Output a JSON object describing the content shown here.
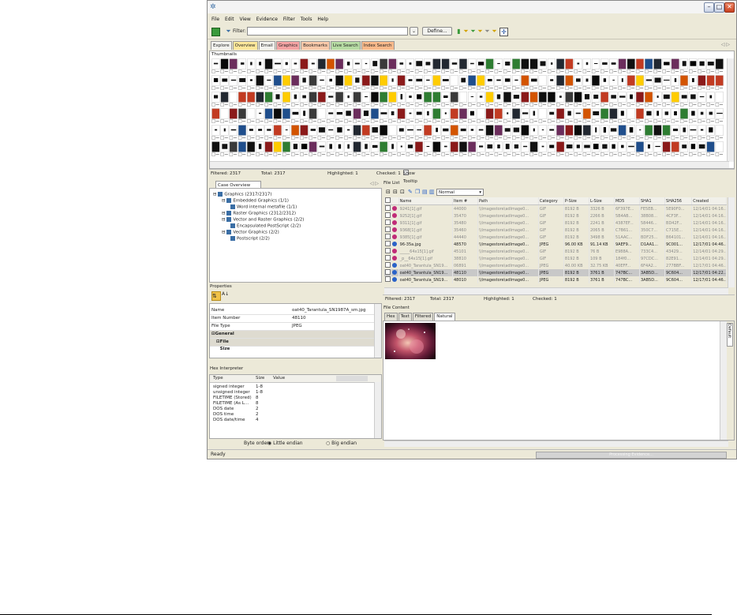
{
  "menu": [
    "File",
    "Edit",
    "View",
    "Evidence",
    "Filter",
    "Tools",
    "Help"
  ],
  "toolbar": {
    "filter_label": "Filter:",
    "define_label": "Define..."
  },
  "view_tabs": [
    {
      "label": "Explore",
      "color": "#f2f2ee"
    },
    {
      "label": "Overview",
      "color": "#fde79a"
    },
    {
      "label": "Email",
      "color": "#f2f2ee"
    },
    {
      "label": "Graphics",
      "color": "#f5a3a3"
    },
    {
      "label": "Bookmarks",
      "color": "#f9c9a9"
    },
    {
      "label": "Live Search",
      "color": "#b6dba3"
    },
    {
      "label": "Index Search",
      "color": "#f9b98a"
    }
  ],
  "thumbnails": {
    "title": "Thumbnails",
    "status": {
      "filtered": "Filtered: 2317",
      "total": "Total: 2317",
      "highlighted": "Highlighted: 1",
      "checked": "Checked: 1",
      "tooltip": "Show Tooltip"
    }
  },
  "case_overview": {
    "tab": "Case Overview",
    "tree": [
      {
        "label": "Graphics (2317/2317)",
        "level": 0
      },
      {
        "label": "Embedded Graphics (1/1)",
        "level": 1
      },
      {
        "label": "Word internal metafile (1/1)",
        "level": 2
      },
      {
        "label": "Raster Graphics (2312/2312)",
        "level": 1
      },
      {
        "label": "Vector and Raster Graphics (2/2)",
        "level": 1
      },
      {
        "label": "Encapsulated PostScript (2/2)",
        "level": 2
      },
      {
        "label": "Vector Graphics (2/2)",
        "level": 1
      },
      {
        "label": "Postscript (2/2)",
        "level": 2
      }
    ]
  },
  "properties": {
    "title": "Properties",
    "rows": [
      {
        "k": "Name",
        "v": "oat40_Tarantula_SN1987A_sm.jpg"
      },
      {
        "k": "Item Number",
        "v": "48110"
      },
      {
        "k": "File Type",
        "v": "JPEG"
      }
    ],
    "section": "General Info",
    "subsection": "File Size"
  },
  "hex_interpreter": {
    "title": "Hex Interpreter",
    "headers": [
      "Type",
      "Size",
      "Value"
    ],
    "rows": [
      {
        "t": "signed integer",
        "s": "1-8"
      },
      {
        "t": "unsigned integer",
        "s": "1-8"
      },
      {
        "t": "FILETIME (Stored)",
        "s": "8"
      },
      {
        "t": "FILETIME (As L...",
        "s": "8"
      },
      {
        "t": "DOS date",
        "s": "2"
      },
      {
        "t": "DOS time",
        "s": "2"
      },
      {
        "t": "DOS date/time",
        "s": "4"
      }
    ],
    "byte_order_label": "Byte order:",
    "little": "Little endian",
    "big": "Big endian"
  },
  "file_list": {
    "title": "File List",
    "view_mode": "Normal",
    "headers": [
      "Name",
      "Item #",
      "Path",
      "Category",
      "P-Size",
      "L-Size",
      "MD5",
      "SHA1",
      "SHA256",
      "Created"
    ],
    "rows": [
      {
        "name": "9241[1].gif",
        "item": "44000",
        "path": "\\\\Imagestore\\adlmage0...",
        "cat": "GIF",
        "psize": "8192 B",
        "lsize": "3326 B",
        "md5": "6F397E...",
        "sha1": "FE5EB...",
        "sha256": "5E90F0...",
        "created": "12/14/01 04:16...",
        "dim": true
      },
      {
        "name": "9252[1].gif",
        "item": "35470",
        "path": "\\\\Imagestore\\adlmage0...",
        "cat": "GIF",
        "psize": "8192 B",
        "lsize": "2266 B",
        "md5": "5B4AB...",
        "sha1": "38B08...",
        "sha256": "4CF3F...",
        "created": "12/14/01 04:16...",
        "dim": true
      },
      {
        "name": "9311[1].gif",
        "item": "35480",
        "path": "\\\\Imagestore\\adlmage0...",
        "cat": "GIF",
        "psize": "8192 B",
        "lsize": "2241 B",
        "md5": "4387EF...",
        "sha1": "58446...",
        "sha256": "BD42F...",
        "created": "12/14/01 04:16...",
        "dim": true
      },
      {
        "name": "9368[1].gif",
        "item": "35460",
        "path": "\\\\Imagestore\\adlmage0...",
        "cat": "GIF",
        "psize": "8192 B",
        "lsize": "2065 B",
        "md5": "C7B61...",
        "sha1": "350C7...",
        "sha256": "C715E...",
        "created": "12/14/01 04:16...",
        "dim": true
      },
      {
        "name": "9385[1].gif",
        "item": "44440",
        "path": "\\\\Imagestore\\adlmage0...",
        "cat": "GIF",
        "psize": "8192 B",
        "lsize": "3498 B",
        "md5": "51AAC...",
        "sha1": "BDF25...",
        "sha256": "B64101...",
        "created": "12/14/01 04:16...",
        "dim": true
      },
      {
        "name": "96-35a.jpg",
        "item": "48570",
        "path": "\\\\Imagestore\\adlmage0...",
        "cat": "JPEG",
        "psize": "96.00 KB",
        "lsize": "91.14 KB",
        "md5": "9AEF9...",
        "sha1": "D1AA1...",
        "sha256": "9C001...",
        "created": "12/17/01 04:46...",
        "dim": false
      },
      {
        "name": "_____64x15[1].gif",
        "item": "45101",
        "path": "\\\\Imagestore\\adlmage0...",
        "cat": "GIF",
        "psize": "8192 B",
        "lsize": "76 B",
        "md5": "E988A...",
        "sha1": "733C4...",
        "sha256": "43429...",
        "created": "12/14/01 04:29...",
        "dim": true
      },
      {
        "name": "_p__64x15[1].gif",
        "item": "38810",
        "path": "\\\\Imagestore\\adlmage0...",
        "cat": "GIF",
        "psize": "8192 B",
        "lsize": "109 B",
        "md5": "184f0...",
        "sha1": "97CDC...",
        "sha256": "82E91...",
        "created": "12/14/01 04:29...",
        "dim": true
      },
      {
        "name": "oat40_Tarantula_SN19...",
        "item": "06891",
        "path": "\\\\Imagestore\\adlmage0...",
        "cat": "JPEG",
        "psize": "40.00 KB",
        "lsize": "32.75 KB",
        "md5": "40EFF...",
        "sha1": "6F4A2...",
        "sha256": "277BBF...",
        "created": "12/17/01 04:46...",
        "dim": true
      },
      {
        "name": "oat40_Tarantula_SN19...",
        "item": "48110",
        "path": "\\\\Imagestore\\adlmage0...",
        "cat": "JPEG",
        "psize": "8192 B",
        "lsize": "3761 B",
        "md5": "747BC...",
        "sha1": "3AB5D...",
        "sha256": "9C604...",
        "created": "12/17/01 04:22...",
        "dim": false,
        "selected": true
      },
      {
        "name": "oat40_Tarantula_SN19...",
        "item": "48010",
        "path": "\\\\Imagestore\\adlmage0...",
        "cat": "JPEG",
        "psize": "8192 B",
        "lsize": "3761 B",
        "md5": "747BC...",
        "sha1": "3AB5D...",
        "sha256": "9C604...",
        "created": "12/17/01 04:46...",
        "dim": false
      }
    ],
    "status": {
      "filtered": "Filtered: 2317",
      "total": "Total: 2317",
      "highlighted": "Highlighted: 1",
      "checked": "Checked: 1"
    }
  },
  "file_content": {
    "title": "File Content",
    "tabs": [
      "Hex",
      "Text",
      "Filtered",
      "Natural"
    ],
    "active_tab": "Natural",
    "side_tab": "Default"
  },
  "status_bar": {
    "text": "Ready",
    "progress_text": "Processing Evidence..."
  }
}
